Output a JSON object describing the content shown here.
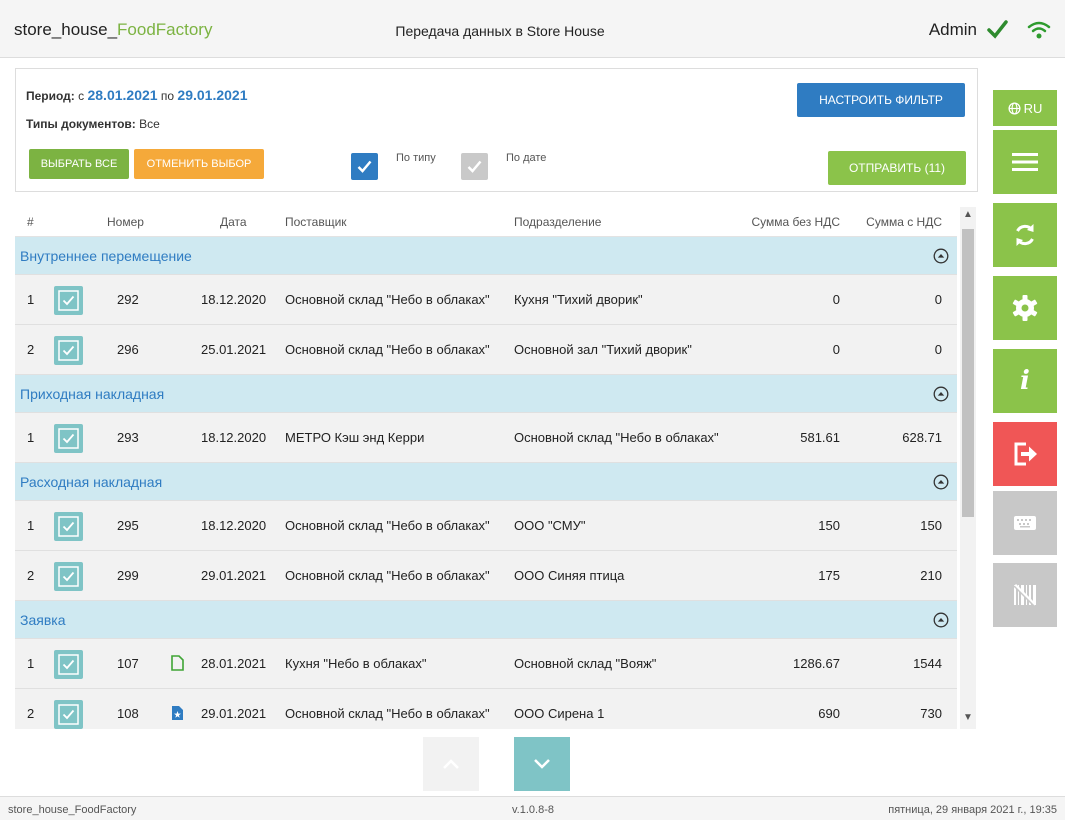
{
  "header": {
    "app_name_prefix": "store_house_",
    "app_name_accent": "FoodFactory",
    "title": "Передача данных в Store House",
    "user": "Admin",
    "status_icons": [
      "check-icon",
      "wifi-icon"
    ]
  },
  "filter": {
    "period_label": "Период:",
    "from_label": "с",
    "from_date": "28.01.2021",
    "to_label": "по",
    "to_date": "29.01.2021",
    "doc_types_label": "Типы документов:",
    "doc_types_value": "Все",
    "select_all": "ВЫБРАТЬ ВСЕ",
    "deselect": "ОТМЕНИТЬ ВЫБОР",
    "by_type_label": "По типу",
    "by_type_checked": true,
    "by_date_label": "По дате",
    "by_date_checked": false,
    "configure_filter": "НАСТРОИТЬ ФИЛЬТР",
    "send": "ОТПРАВИТЬ (11)"
  },
  "sidebar": {
    "lang": "RU",
    "buttons": [
      "globe-icon",
      "menu-icon",
      "sync-icon",
      "settings-icon",
      "info-icon",
      "logout-icon",
      "keyboard-icon",
      "barcode-off-icon"
    ]
  },
  "grid": {
    "columns": [
      "#",
      "Номер",
      "Дата",
      "Поставщик",
      "Подразделение",
      "Сумма без НДС",
      "Сумма с НДС"
    ],
    "groups": [
      {
        "name": "Внутреннее перемещение",
        "rows": [
          {
            "idx": "1",
            "num": "292",
            "doc": "",
            "date": "18.12.2020",
            "supplier": "Основной склад \"Небо в облаках\"",
            "department": "Кухня \"Тихий дворик\"",
            "sum": "0",
            "sum_vat": "0"
          },
          {
            "idx": "2",
            "num": "296",
            "doc": "",
            "date": "25.01.2021",
            "supplier": "Основной склад \"Небо в облаках\"",
            "department": "Основной зал \"Тихий дворик\"",
            "sum": "0",
            "sum_vat": "0"
          }
        ]
      },
      {
        "name": "Приходная накладная",
        "rows": [
          {
            "idx": "1",
            "num": "293",
            "doc": "",
            "date": "18.12.2020",
            "supplier": "МЕТРО Кэш энд Керри",
            "department": "Основной склад \"Небо в облаках\"",
            "sum": "581.61",
            "sum_vat": "628.71"
          }
        ]
      },
      {
        "name": "Расходная накладная",
        "rows": [
          {
            "idx": "1",
            "num": "295",
            "doc": "",
            "date": "18.12.2020",
            "supplier": "Основной склад \"Небо в облаках\"",
            "department": "ООО \"СМУ\"",
            "sum": "150",
            "sum_vat": "150"
          },
          {
            "idx": "2",
            "num": "299",
            "doc": "",
            "date": "29.01.2021",
            "supplier": "Основной склад \"Небо в облаках\"",
            "department": "ООО Синяя птица",
            "sum": "175",
            "sum_vat": "210"
          }
        ]
      },
      {
        "name": "Заявка",
        "rows": [
          {
            "idx": "1",
            "num": "107",
            "doc": "document-icon",
            "date": "28.01.2021",
            "supplier": "Кухня \"Небо в облаках\"",
            "department": "Основной склад \"Вояж\"",
            "sum": "1286.67",
            "sum_vat": "1544"
          },
          {
            "idx": "2",
            "num": "108",
            "doc": "document-star-icon",
            "date": "29.01.2021",
            "supplier": "Основной склад \"Небо в облаках\"",
            "department": "ООО Сирена 1",
            "sum": "690",
            "sum_vat": "730"
          }
        ]
      }
    ]
  },
  "footer": {
    "app": "store_house_FoodFactory",
    "version": "v.1.0.8-8",
    "datetime": "пятница, 29 января 2021 г., 19:35"
  },
  "colors": {
    "green": "#8bc34a",
    "blue": "#2f7cc2",
    "orange": "#f5a93a",
    "red": "#f05656",
    "teal": "#7fc4c6",
    "group_bg": "#cfe9f1"
  }
}
